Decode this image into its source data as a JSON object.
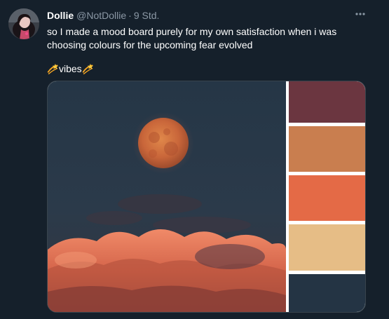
{
  "tweet": {
    "display_name": "Dollie",
    "handle": "@NotDollie",
    "separator": "·",
    "time": "9 Std.",
    "text": "so I made a mood board purely for my own satisfaction when i was choosing colours for the upcoming fear evolved",
    "vibes_word": "vibes"
  },
  "icons": {
    "more": "more-horizontal-icon",
    "emoji": "dizzy-star-emoji"
  },
  "palette": {
    "colors": [
      "#6b3640",
      "#c97e4f",
      "#e46a46",
      "#e6bd86",
      "#243444"
    ]
  },
  "theme": {
    "background": "#15202b",
    "text": "#ffffff",
    "secondary_text": "#8b98a5",
    "border": "#38444d"
  }
}
